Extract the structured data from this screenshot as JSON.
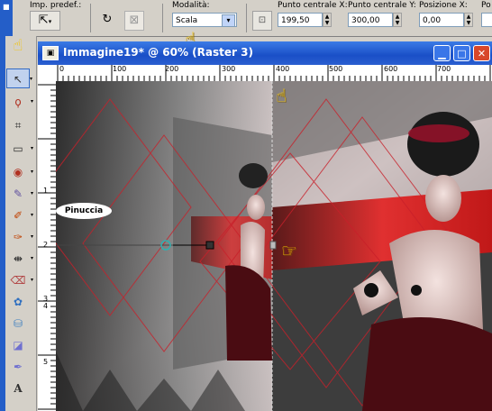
{
  "toolbar": {
    "preset_label": "Imp. predef.:",
    "mode_label": "Modalità:",
    "mode_value": "Scala",
    "center_x_label": "Punto centrale X:",
    "center_x_value": "199,50",
    "center_y_label": "Punto centrale Y:",
    "center_y_value": "300,00",
    "pos_x_label": "Posizione X:",
    "pos_x_value": "0,00",
    "pos_trunc_label": "Po"
  },
  "window": {
    "title": "Immagine19* @  60% (Raster 3)",
    "minimize_icon": "minimize-icon",
    "maximize_icon": "maximize-icon",
    "close_icon": "close-icon"
  },
  "ruler_h": [
    "0",
    "100",
    "200",
    "300",
    "400",
    "500",
    "600",
    "700"
  ],
  "ruler_v": [
    "1",
    "2",
    "3",
    "4",
    "5"
  ],
  "watermark": "Pinuccia",
  "tools": [
    {
      "icon": "hand-icon"
    },
    {
      "icon": "pick-arrow-icon"
    },
    {
      "icon": "lasso-icon"
    },
    {
      "icon": "crop-icon"
    },
    {
      "icon": "rectangle-select-icon"
    },
    {
      "icon": "eye-icon"
    },
    {
      "icon": "clone-brush-icon"
    },
    {
      "icon": "brush-icon"
    },
    {
      "icon": "smudge-icon"
    },
    {
      "icon": "dodge-icon"
    },
    {
      "icon": "eraser-icon"
    },
    {
      "icon": "picture-tube-icon"
    },
    {
      "icon": "fill-bucket-icon"
    },
    {
      "icon": "eraser2-icon"
    },
    {
      "icon": "pen-icon"
    },
    {
      "icon": "text-icon"
    }
  ],
  "colors": {
    "title_bar": "#1a4fc7",
    "accent_red": "#c8202a",
    "cursor": "#f5c400"
  }
}
